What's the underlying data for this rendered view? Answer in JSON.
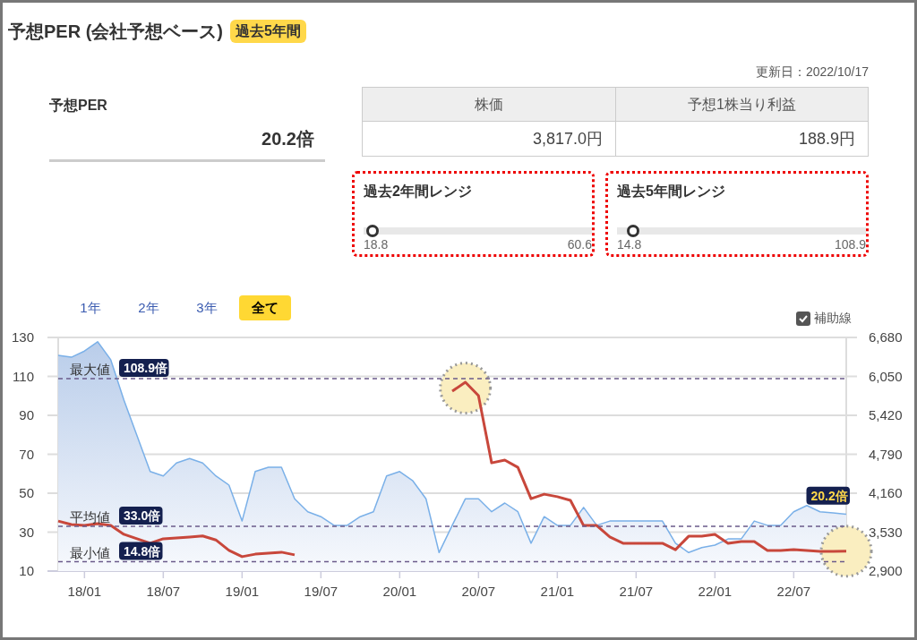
{
  "title": "予想PER (会社予想ベース)",
  "title_badge": "過去5年間",
  "per": {
    "label": "予想PER",
    "value": "20.2倍"
  },
  "updated": "更新日：2022/10/17",
  "price_table": {
    "columns": [
      "株価",
      "予想1株当り利益"
    ],
    "rows": [
      [
        "3,817.0円",
        "188.9円"
      ]
    ]
  },
  "ranges": [
    {
      "title": "過去2年間レンジ",
      "min": "18.8",
      "max": "60.6",
      "level": 0.03
    },
    {
      "title": "過去5年間レンジ",
      "min": "14.8",
      "max": "108.9",
      "level": 0.057
    }
  ],
  "period_tabs": [
    {
      "label": "1年",
      "selected": false
    },
    {
      "label": "2年",
      "selected": false
    },
    {
      "label": "3年",
      "selected": false
    },
    {
      "label": "全て",
      "selected": true
    }
  ],
  "aux_lines": {
    "label": "補助線",
    "checked": true
  },
  "chart_data": {
    "type": "line",
    "categories": [
      null,
      null,
      "18/01",
      null,
      null,
      null,
      null,
      null,
      "18/07",
      null,
      null,
      null,
      null,
      null,
      "19/01",
      null,
      null,
      null,
      null,
      null,
      "19/07",
      null,
      null,
      null,
      null,
      null,
      "20/01",
      null,
      null,
      null,
      null,
      null,
      "20/07",
      null,
      null,
      null,
      null,
      null,
      "21/01",
      null,
      null,
      null,
      null,
      null,
      "21/07",
      null,
      null,
      null,
      null,
      null,
      "22/01",
      null,
      null,
      null,
      null,
      null,
      "22/07",
      null,
      null,
      null,
      null
    ],
    "ylim": [
      10,
      130
    ],
    "yticks": [
      10,
      30,
      50,
      70,
      90,
      110,
      130
    ],
    "y2lim": [
      2900,
      6680
    ],
    "y2ticks": [
      {
        "value": 2900,
        "label": "2,900"
      },
      {
        "value": 3530,
        "label": "3,530"
      },
      {
        "value": 4160,
        "label": "4,160"
      },
      {
        "value": 4790,
        "label": "4,790"
      },
      {
        "value": 5420,
        "label": "5,420"
      },
      {
        "value": 6050,
        "label": "6,050"
      },
      {
        "value": 6680,
        "label": "6,680"
      }
    ],
    "series": [
      {
        "color": "#7ab0e8",
        "axis": "y2",
        "values": [
          6390,
          6360,
          6460,
          6610,
          6320,
          5670,
          5090,
          4510,
          4440,
          4650,
          4720,
          4650,
          4440,
          4290,
          3710,
          4510,
          4580,
          4580,
          4070,
          3860,
          3780,
          3640,
          3640,
          3780,
          3860,
          4440,
          4510,
          4360,
          4070,
          3200,
          3640,
          4070,
          4070,
          3860,
          4000,
          3860,
          3350,
          3780,
          3640,
          3640,
          3930,
          3640,
          3710,
          3710,
          3710,
          3710,
          3710,
          3350,
          3200,
          3280,
          3320,
          3420,
          3420,
          3710,
          3640,
          3640,
          3860,
          3960,
          3860,
          3840,
          3820
        ]
      },
      {
        "name": "最大値",
        "color": "#6b5b8b",
        "line_style": "dashed",
        "values": [
          108.9,
          108.9,
          108.9,
          108.9,
          108.9,
          108.9,
          108.9,
          108.9,
          108.9,
          108.9,
          108.9,
          108.9,
          108.9,
          108.9,
          108.9,
          108.9,
          108.9,
          108.9,
          108.9,
          108.9,
          108.9,
          108.9,
          108.9,
          108.9,
          108.9,
          108.9,
          108.9,
          108.9,
          108.9,
          108.9,
          108.9,
          108.9,
          108.9,
          108.9,
          108.9,
          108.9,
          108.9,
          108.9,
          108.9,
          108.9,
          108.9,
          108.9,
          108.9,
          108.9,
          108.9,
          108.9,
          108.9,
          108.9,
          108.9,
          108.9,
          108.9,
          108.9,
          108.9,
          108.9,
          108.9,
          108.9,
          108.9,
          108.9,
          108.9,
          108.9,
          108.9
        ]
      },
      {
        "name": "平均値",
        "color": "#6b5b8b",
        "line_style": "dashed",
        "values": [
          33.0,
          33.0,
          33.0,
          33.0,
          33.0,
          33.0,
          33.0,
          33.0,
          33.0,
          33.0,
          33.0,
          33.0,
          33.0,
          33.0,
          33.0,
          33.0,
          33.0,
          33.0,
          33.0,
          33.0,
          33.0,
          33.0,
          33.0,
          33.0,
          33.0,
          33.0,
          33.0,
          33.0,
          33.0,
          33.0,
          33.0,
          33.0,
          33.0,
          33.0,
          33.0,
          33.0,
          33.0,
          33.0,
          33.0,
          33.0,
          33.0,
          33.0,
          33.0,
          33.0,
          33.0,
          33.0,
          33.0,
          33.0,
          33.0,
          33.0,
          33.0,
          33.0,
          33.0,
          33.0,
          33.0,
          33.0,
          33.0,
          33.0,
          33.0,
          33.0,
          33.0
        ]
      },
      {
        "name": "最小値",
        "color": "#6b5b8b",
        "line_style": "dashed",
        "values": [
          14.8,
          14.8,
          14.8,
          14.8,
          14.8,
          14.8,
          14.8,
          14.8,
          14.8,
          14.8,
          14.8,
          14.8,
          14.8,
          14.8,
          14.8,
          14.8,
          14.8,
          14.8,
          14.8,
          14.8,
          14.8,
          14.8,
          14.8,
          14.8,
          14.8,
          14.8,
          14.8,
          14.8,
          14.8,
          14.8,
          14.8,
          14.8,
          14.8,
          14.8,
          14.8,
          14.8,
          14.8,
          14.8,
          14.8,
          14.8,
          14.8,
          14.8,
          14.8,
          14.8,
          14.8,
          14.8,
          14.8,
          14.8,
          14.8,
          14.8,
          14.8,
          14.8,
          14.8,
          14.8,
          14.8,
          14.8,
          14.8,
          14.8,
          14.8,
          14.8,
          14.8
        ]
      },
      {
        "color": "#c8473b",
        "values": [
          35.7,
          33.9,
          33.4,
          34.4,
          33.4,
          28.9,
          26.6,
          24.3,
          26.6,
          27,
          27.5,
          28,
          26,
          20.6,
          17.4,
          18.7,
          19.2,
          19.7,
          18.3,
          null,
          null,
          null,
          null,
          null,
          null,
          null,
          null,
          null,
          null,
          null,
          102.4,
          107,
          100.1,
          65.6,
          67,
          63.3,
          47.2,
          49.5,
          48.2,
          46.3,
          33.4,
          33.4,
          27.5,
          24.3,
          24.3,
          24.3,
          24.3,
          21,
          27.9,
          27.9,
          28.9,
          24.3,
          25.2,
          25.2,
          20.6,
          20.6,
          21,
          20.6,
          20.1,
          20.1,
          20.2
        ]
      }
    ],
    "grid": true,
    "annotations": [
      "108.9倍",
      "33.0倍",
      "14.8倍",
      "20.2倍"
    ]
  }
}
